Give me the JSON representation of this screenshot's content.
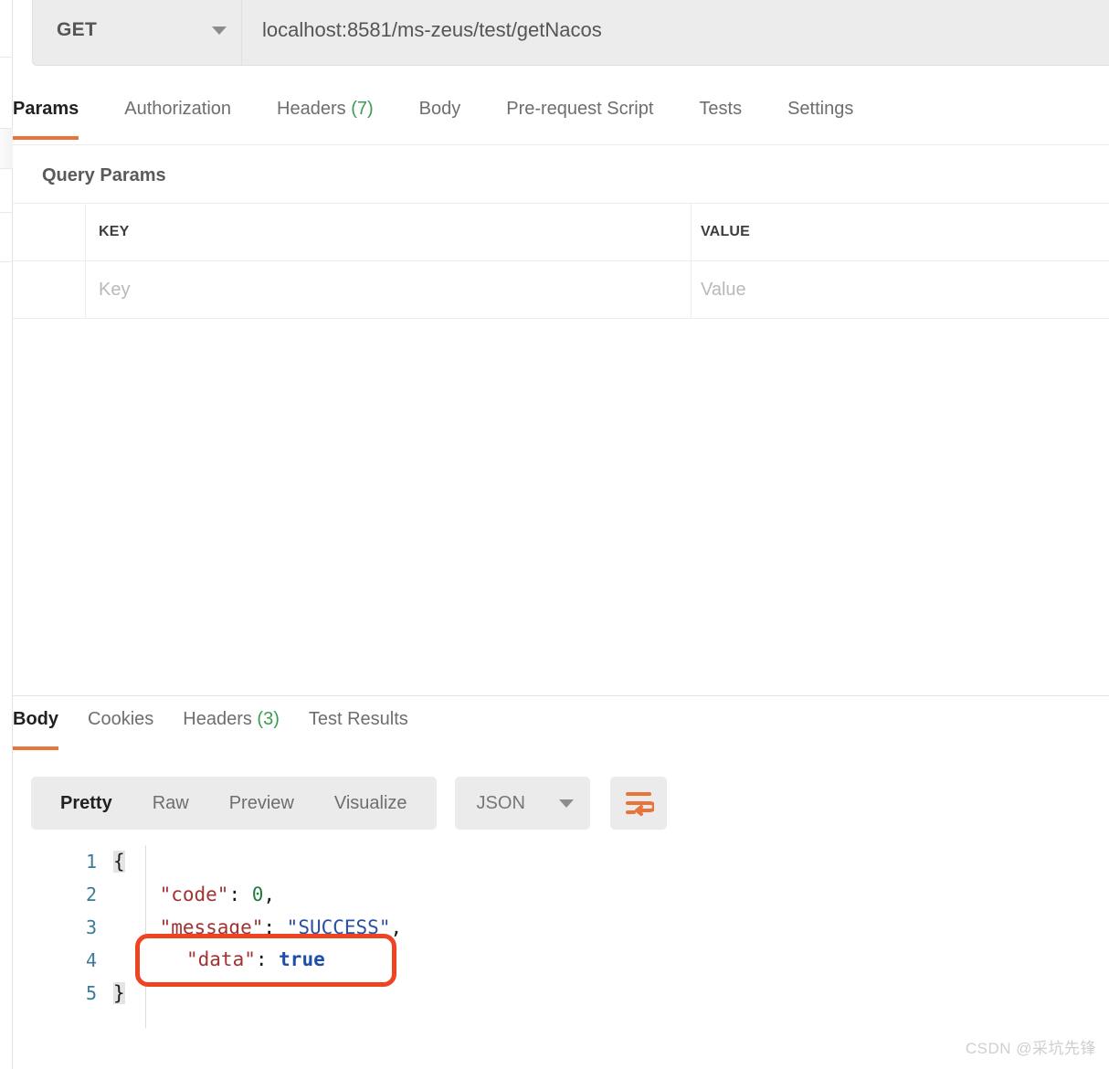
{
  "request": {
    "method": "GET",
    "method_icon": "chevron-down-icon",
    "url": "localhost:8581/ms-zeus/test/getNacos",
    "tabs": [
      {
        "label": "Params",
        "count": "",
        "active": true
      },
      {
        "label": "Authorization",
        "count": "",
        "active": false
      },
      {
        "label": "Headers",
        "count": "(7)",
        "active": false
      },
      {
        "label": "Body",
        "count": "",
        "active": false
      },
      {
        "label": "Pre-request Script",
        "count": "",
        "active": false
      },
      {
        "label": "Tests",
        "count": "",
        "active": false
      },
      {
        "label": "Settings",
        "count": "",
        "active": false
      }
    ],
    "query_params": {
      "title": "Query Params",
      "columns": [
        "KEY",
        "VALUE"
      ],
      "rows": [
        {
          "key_placeholder": "Key",
          "value_placeholder": "Value"
        }
      ]
    }
  },
  "response": {
    "tabs": [
      {
        "label": "Body",
        "count": "",
        "active": true
      },
      {
        "label": "Cookies",
        "count": "",
        "active": false
      },
      {
        "label": "Headers",
        "count": "(3)",
        "active": false
      },
      {
        "label": "Test Results",
        "count": "",
        "active": false
      }
    ],
    "format_bar": {
      "segments": [
        {
          "label": "Pretty",
          "active": true
        },
        {
          "label": "Raw",
          "active": false
        },
        {
          "label": "Preview",
          "active": false
        },
        {
          "label": "Visualize",
          "active": false
        }
      ],
      "language": "JSON",
      "language_icon": "chevron-down-icon",
      "wrap_icon": "word-wrap-icon"
    },
    "body": {
      "language": "json",
      "lines": [
        {
          "n": "1",
          "tokens": [
            {
              "t": "{",
              "c": "tok-brace"
            }
          ]
        },
        {
          "n": "2",
          "tokens": [
            {
              "t": "    ",
              "c": "tok-punc"
            },
            {
              "t": "\"code\"",
              "c": "tok-key"
            },
            {
              "t": ": ",
              "c": "tok-punc"
            },
            {
              "t": "0",
              "c": "tok-num"
            },
            {
              "t": ",",
              "c": "tok-punc"
            }
          ]
        },
        {
          "n": "3",
          "tokens": [
            {
              "t": "    ",
              "c": "tok-punc"
            },
            {
              "t": "\"message\"",
              "c": "tok-key"
            },
            {
              "t": ": ",
              "c": "tok-punc"
            },
            {
              "t": "\"SUCCESS\"",
              "c": "tok-str"
            },
            {
              "t": ",",
              "c": "tok-punc"
            }
          ]
        },
        {
          "n": "4",
          "tokens": [
            {
              "t": "    ",
              "c": "tok-punc"
            },
            {
              "t": "\"data\"",
              "c": "tok-key"
            },
            {
              "t": ": ",
              "c": "tok-punc"
            },
            {
              "t": "true",
              "c": "tok-bool"
            }
          ]
        },
        {
          "n": "5",
          "tokens": [
            {
              "t": "}",
              "c": "tok-brace"
            }
          ]
        }
      ]
    },
    "annotation": {
      "shape": "rounded-rectangle",
      "color": "#ee4422",
      "highlighted_tokens": [
        {
          "t": "\"data\"",
          "c": "tok-key"
        },
        {
          "t": ": ",
          "c": "tok-punc"
        },
        {
          "t": "true",
          "c": "tok-bool"
        }
      ]
    }
  },
  "watermark": "CSDN @采坑先锋",
  "colors": {
    "accent": "#e8743b",
    "count_green": "#3a9d4e",
    "annotation_red": "#ee4422",
    "chrome_gray": "#ececec"
  }
}
